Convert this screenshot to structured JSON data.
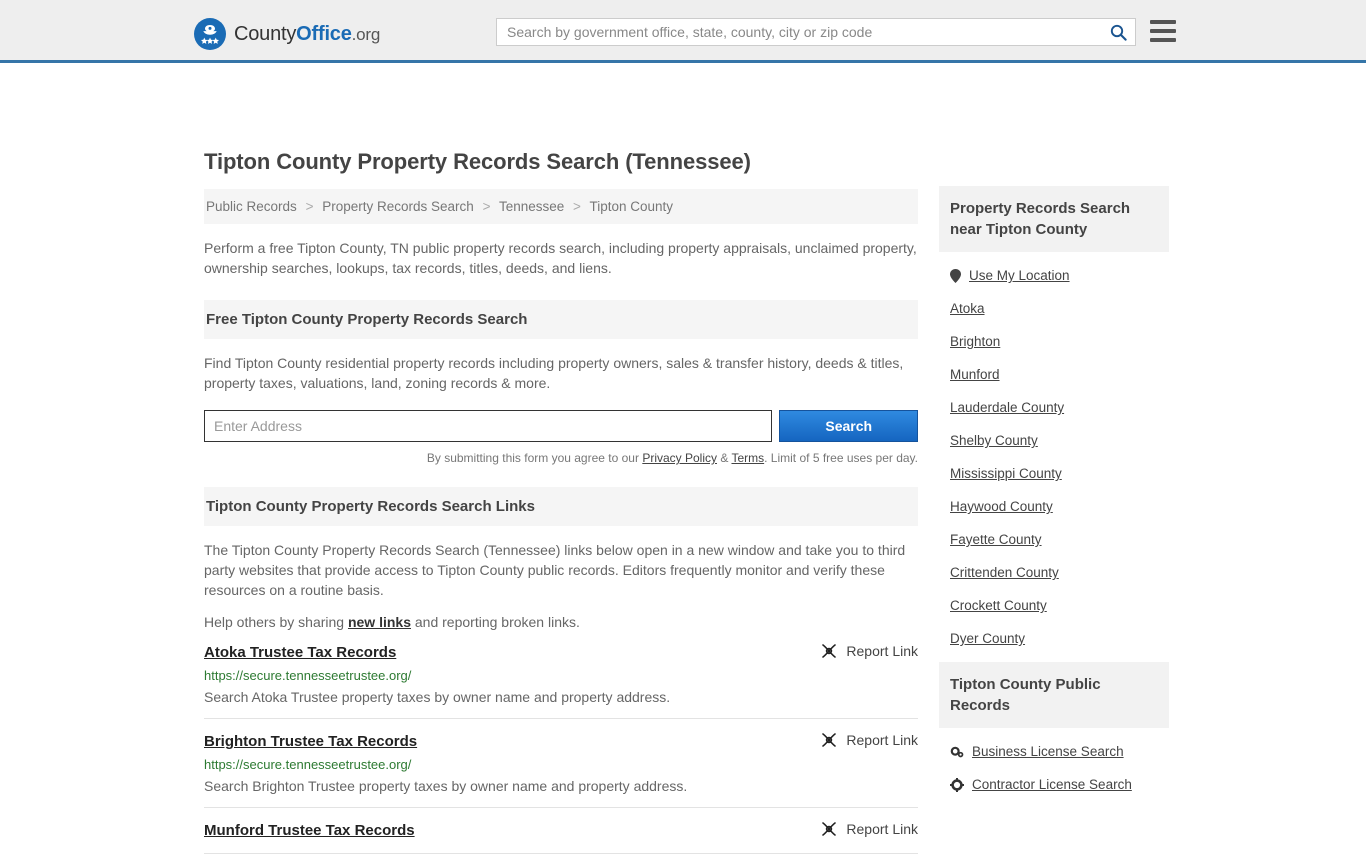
{
  "header": {
    "logo_text_1": "County",
    "logo_text_2": "Office",
    "logo_text_3": ".org",
    "logo_icon": "eagle-seal-icon",
    "search_placeholder": "Search by government office, state, county, city or zip code",
    "search_value": "",
    "search_icon": "search-icon",
    "menu_icon": "hamburger-menu-icon"
  },
  "main": {
    "title": "Tipton County Property Records Search (Tennessee)",
    "breadcrumb": [
      "Public Records",
      "Property Records Search",
      "Tennessee",
      "Tipton County"
    ],
    "breadcrumb_separator": ">",
    "intro": "Perform a free Tipton County, TN public property records search, including property appraisals, unclaimed property, ownership searches, lookups, tax records, titles, deeds, and liens.",
    "search_section": {
      "heading": "Free Tipton County Property Records Search",
      "description": "Find Tipton County residential property records including property owners, sales & transfer history, deeds & titles, property taxes, valuations, land, zoning records & more.",
      "input_placeholder": "Enter Address",
      "input_value": "",
      "button_label": "Search",
      "disclaimer_prefix": "By submitting this form you agree to our ",
      "privacy_label": "Privacy Policy",
      "disclaimer_amp": " & ",
      "terms_label": "Terms",
      "disclaimer_suffix": ". Limit of 5 free uses per day."
    },
    "links_section": {
      "heading": "Tipton County Property Records Search Links",
      "description": "The Tipton County Property Records Search (Tennessee) links below open in a new window and take you to third party websites that provide access to Tipton County public records. Editors frequently monitor and verify these resources on a routine basis.",
      "help_prefix": "Help others by sharing ",
      "help_link_label": "new links",
      "help_suffix": " and reporting broken links.",
      "report_label": "Report Link",
      "report_icon": "broken-link-icon"
    },
    "results": [
      {
        "title": "Atoka Trustee Tax Records",
        "url": "https://secure.tennesseetrustee.org/",
        "description": "Search Atoka Trustee property taxes by owner name and property address."
      },
      {
        "title": "Brighton Trustee Tax Records",
        "url": "https://secure.tennesseetrustee.org/",
        "description": "Search Brighton Trustee property taxes by owner name and property address."
      },
      {
        "title": "Munford Trustee Tax Records",
        "url": "",
        "description": ""
      }
    ]
  },
  "sidebar": {
    "nearby": {
      "heading": "Property Records Search near Tipton County",
      "location_icon": "map-pin-icon",
      "location_label": "Use My Location",
      "items": [
        "Atoka",
        "Brighton",
        "Munford",
        "Lauderdale County",
        "Shelby County",
        "Mississippi County",
        "Haywood County",
        "Fayette County",
        "Crittenden County",
        "Crockett County",
        "Dyer County"
      ]
    },
    "public_records": {
      "heading": "Tipton County Public Records",
      "items": [
        {
          "label": "Business License Search",
          "icon": "gears-icon"
        },
        {
          "label": "Contractor License Search",
          "icon": "gear-icon"
        }
      ]
    }
  },
  "colors": {
    "brand_blue": "#1a6bb5",
    "header_bg": "#eeeeee",
    "header_border": "#3575a8",
    "button_blue": "#1565c0",
    "url_green": "#2d7a32",
    "section_bg": "#f5f5f5"
  }
}
